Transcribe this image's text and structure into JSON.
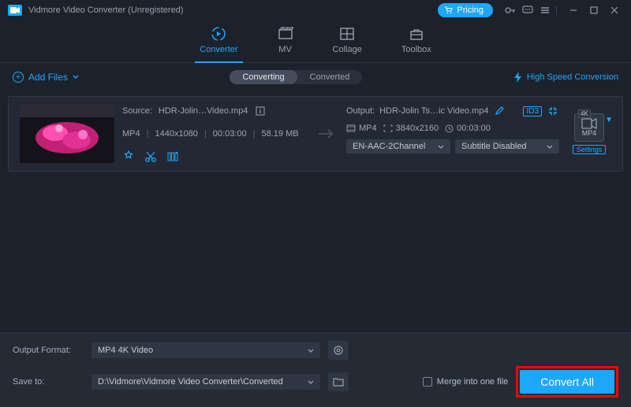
{
  "titlebar": {
    "app_title": "Vidmore Video Converter (Unregistered)",
    "pricing_label": "Pricing"
  },
  "main_tabs": {
    "converter": "Converter",
    "mv": "MV",
    "collage": "Collage",
    "toolbox": "Toolbox"
  },
  "toolbar": {
    "add_files": "Add Files",
    "sub_converting": "Converting",
    "sub_converted": "Converted",
    "high_speed": "High Speed Conversion"
  },
  "item": {
    "source_label": "Source:",
    "source_name": "HDR-Jolin…Video.mp4",
    "src_format": "MP4",
    "src_res": "1440x1080",
    "src_dur": "00:03:00",
    "src_size": "58.19 MB",
    "output_label": "Output:",
    "output_name": "HDR-Jolin Ts…ic Video.mp4",
    "id3": "ID3",
    "out_format": "MP4",
    "out_res": "3840x2160",
    "out_dur": "00:03:00",
    "audio_sel": "EN-AAC-2Channel",
    "subtitle_sel": "Subtitle Disabled",
    "fmt_badge_4k": "4K",
    "fmt_ext": "MP4",
    "settings_label": "Settings"
  },
  "bottom": {
    "output_format_label": "Output Format:",
    "output_format_value": "MP4 4K Video",
    "save_to_label": "Save to:",
    "save_to_value": "D:\\Vidmore\\Vidmore Video Converter\\Converted",
    "merge_label": "Merge into one file",
    "convert_label": "Convert All"
  }
}
